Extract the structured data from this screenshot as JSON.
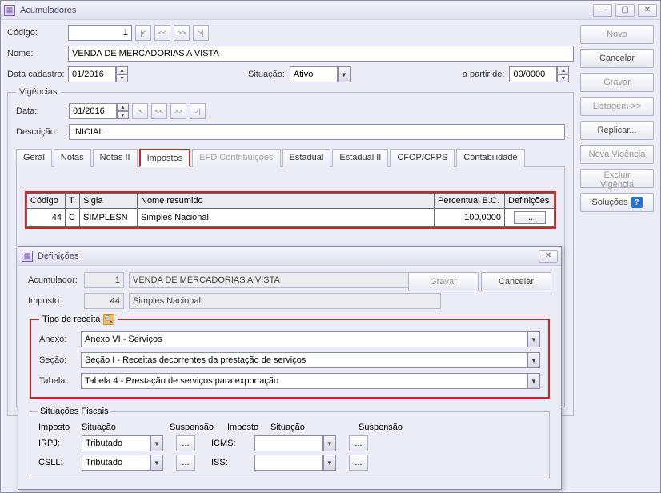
{
  "main": {
    "title": "Acumuladores",
    "labels": {
      "codigo": "Código:",
      "nome": "Nome:",
      "dataCadastro": "Data cadastro:",
      "situacao": "Situação:",
      "apartir": "a partir de:"
    },
    "codigo": "1",
    "nome": "VENDA DE MERCADORIAS A VISTA",
    "dataCadastro": "01/2016",
    "situacao": "Ativo",
    "aPartirDe": "00/0000"
  },
  "rightButtons": {
    "novo": "Novo",
    "cancelar": "Cancelar",
    "gravar": "Gravar",
    "listagem": "Listagem >>",
    "replicar": "Replicar...",
    "novaVig": "Nova Vigência",
    "excluirVig": "Excluir Vigência",
    "solucoes": "Soluções"
  },
  "vigencias": {
    "legend": "Vigências",
    "labels": {
      "data": "Data:",
      "descricao": "Descrição:"
    },
    "data": "01/2016",
    "descricao": "INICIAL"
  },
  "tabs": [
    "Geral",
    "Notas",
    "Notas II",
    "Impostos",
    "EFD Contribuições",
    "Estadual",
    "Estadual II",
    "CFOP/CFPS",
    "Contabilidade"
  ],
  "impostosTable": {
    "headers": {
      "codigo": "Código",
      "t": "T",
      "sigla": "Sigla",
      "nome": "Nome resumido",
      "perc": "Percentual B.C.",
      "def": "Definições"
    },
    "rows": [
      {
        "codigo": "44",
        "t": "C",
        "sigla": "SIMPLESN",
        "nome": "Simples Nacional",
        "perc": "100,0000",
        "def": "..."
      }
    ]
  },
  "definicoes": {
    "title": "Definições",
    "labels": {
      "acumulador": "Acumulador:",
      "imposto": "Imposto:"
    },
    "acumulador": {
      "code": "1",
      "text": "VENDA DE MERCADORIAS A VISTA"
    },
    "imposto": {
      "code": "44",
      "text": "Simples Nacional"
    },
    "buttons": {
      "gravar": "Gravar",
      "cancelar": "Cancelar"
    },
    "tipoReceita": {
      "legend": "Tipo de receita",
      "labels": {
        "anexo": "Anexo:",
        "secao": "Seção:",
        "tabela": "Tabela:"
      },
      "anexo": "Anexo VI - Serviços",
      "secao": "Seção I - Receitas decorrentes da prestação de serviços",
      "tabela": "Tabela 4 - Prestação de serviços para exportação"
    },
    "sitFiscais": {
      "legend": "Situações Fiscais",
      "headers": {
        "imposto": "Imposto",
        "situacao": "Situação",
        "susp": "Suspensão"
      },
      "rows": [
        {
          "imp1": "IRPJ:",
          "sit1": "Tributado",
          "imp2": "ICMS:",
          "sit2": ""
        },
        {
          "imp1": "CSLL:",
          "sit1": "Tributado",
          "imp2": "ISS:",
          "sit2": ""
        }
      ],
      "suspBtn": "..."
    }
  }
}
